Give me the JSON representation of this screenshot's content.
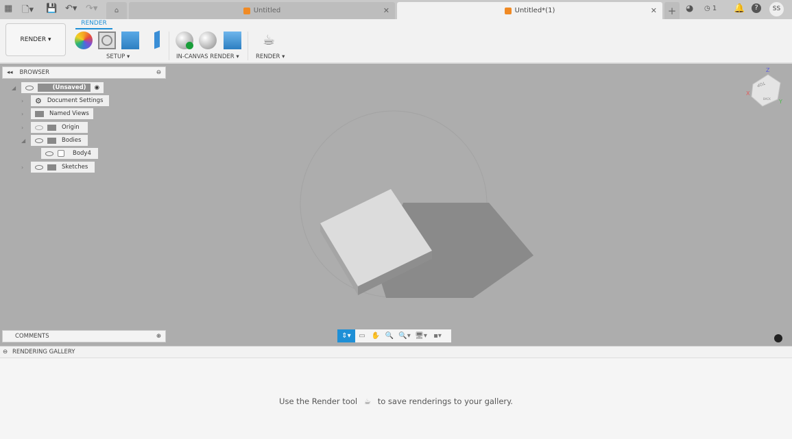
{
  "tabs": [
    {
      "label": "Untitled"
    },
    {
      "label": "Untitled*(1)"
    }
  ],
  "header": {
    "job_count": "1",
    "user_initials": "SS"
  },
  "toolbar": {
    "workspace": "RENDER",
    "tab": "RENDER",
    "groups": {
      "setup": "SETUP",
      "in_canvas": "IN-CANVAS RENDER",
      "render": "RENDER"
    }
  },
  "browser": {
    "title": "BROWSER",
    "root": "(Unsaved)",
    "items": [
      {
        "label": "Document Settings"
      },
      {
        "label": "Named Views"
      },
      {
        "label": "Origin"
      },
      {
        "label": "Bodies"
      },
      {
        "label": "Body4"
      },
      {
        "label": "Sketches"
      }
    ]
  },
  "viewcube": {
    "top": "TOP",
    "back": "BACK",
    "x": "X",
    "y": "Y",
    "z": "Z"
  },
  "comments": {
    "title": "COMMENTS"
  },
  "gallery": {
    "title": "RENDERING GALLERY",
    "hint_before": "Use the Render tool",
    "hint_after": "to save renderings to your gallery."
  },
  "colors": {
    "accent": "#1e8fd6",
    "viewport": "#adadad",
    "brand_orange": "#f08a24"
  }
}
